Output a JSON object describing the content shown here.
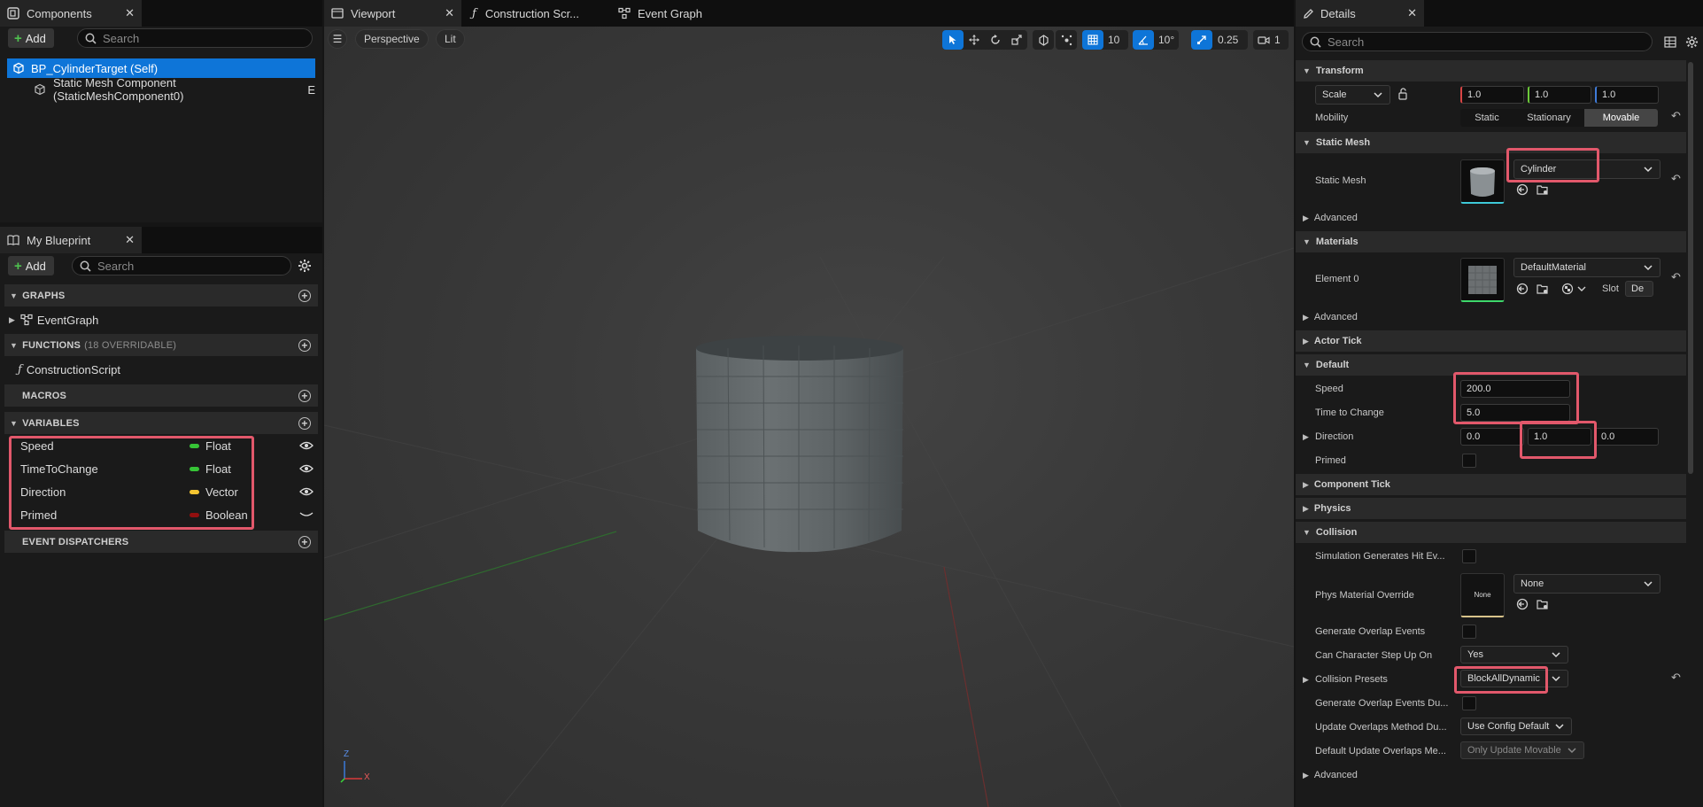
{
  "components_panel": {
    "tab_label": "Components",
    "add_label": "Add",
    "search_placeholder": "Search",
    "tree": [
      {
        "label": "BP_CylinderTarget (Self)"
      },
      {
        "label": "Static Mesh Component (StaticMeshComponent0)",
        "suffix": "E"
      }
    ]
  },
  "mybp_panel": {
    "tab_label": "My Blueprint",
    "add_label": "Add",
    "search_placeholder": "Search",
    "sections": {
      "graphs": "GRAPHS",
      "functions": "FUNCTIONS",
      "functions_sub": "(18 OVERRIDABLE)",
      "macros": "MACROS",
      "variables": "VARIABLES",
      "dispatchers": "EVENT DISPATCHERS"
    },
    "graphs_items": [
      "EventGraph"
    ],
    "functions_items": [
      "ConstructionScript"
    ],
    "variables": [
      {
        "name": "Speed",
        "type": "Float",
        "color": "#36c436"
      },
      {
        "name": "TimeToChange",
        "type": "Float",
        "color": "#36c436"
      },
      {
        "name": "Direction",
        "type": "Vector",
        "color": "#f5c531"
      },
      {
        "name": "Primed",
        "type": "Boolean",
        "color": "#930f0f"
      }
    ]
  },
  "viewport": {
    "tabs": [
      "Viewport",
      "Construction Scr...",
      "Event Graph"
    ],
    "perspective_label": "Perspective",
    "lit_label": "Lit",
    "grid_snap": "10",
    "rot_snap": "10°",
    "scale_snap": "0.25",
    "camera_speed": "1",
    "axis_x": "X",
    "axis_z": "Z"
  },
  "details": {
    "tab_label": "Details",
    "search_placeholder": "Search",
    "transform": {
      "title": "Transform",
      "scale_label": "Scale",
      "scale": [
        "1.0",
        "1.0",
        "1.0"
      ],
      "mobility_label": "Mobility",
      "mobility_options": [
        "Static",
        "Stationary",
        "Movable"
      ],
      "mobility_selected": "Movable"
    },
    "static_mesh": {
      "title": "Static Mesh",
      "label": "Static Mesh",
      "value": "Cylinder",
      "advanced": "Advanced"
    },
    "materials": {
      "title": "Materials",
      "element_label": "Element 0",
      "value": "DefaultMaterial",
      "slot_label": "Slot",
      "slot_value": "De",
      "advanced": "Advanced"
    },
    "actor_tick": "Actor Tick",
    "default": {
      "title": "Default",
      "speed_label": "Speed",
      "speed": "200.0",
      "time_label": "Time to Change",
      "time": "5.0",
      "direction_label": "Direction",
      "direction": [
        "0.0",
        "1.0",
        "0.0"
      ],
      "primed_label": "Primed"
    },
    "component_tick": "Component Tick",
    "physics": "Physics",
    "collision": {
      "title": "Collision",
      "sim_hit_label": "Simulation Generates Hit Ev...",
      "phys_mat_label": "Phys Material Override",
      "phys_mat_thumb": "None",
      "phys_mat_value": "None",
      "overlap_label": "Generate Overlap Events",
      "step_label": "Can Character Step Up On",
      "step_value": "Yes",
      "presets_label": "Collision Presets",
      "presets_value": "BlockAllDynamic",
      "overlap_during_label": "Generate Overlap Events Du...",
      "update_method_label": "Update Overlaps Method Du...",
      "update_method_value": "Use Config Default",
      "default_update_label": "Default Update Overlaps Me...",
      "default_update_value": "Only Update Movable"
    },
    "advanced": "Advanced"
  }
}
